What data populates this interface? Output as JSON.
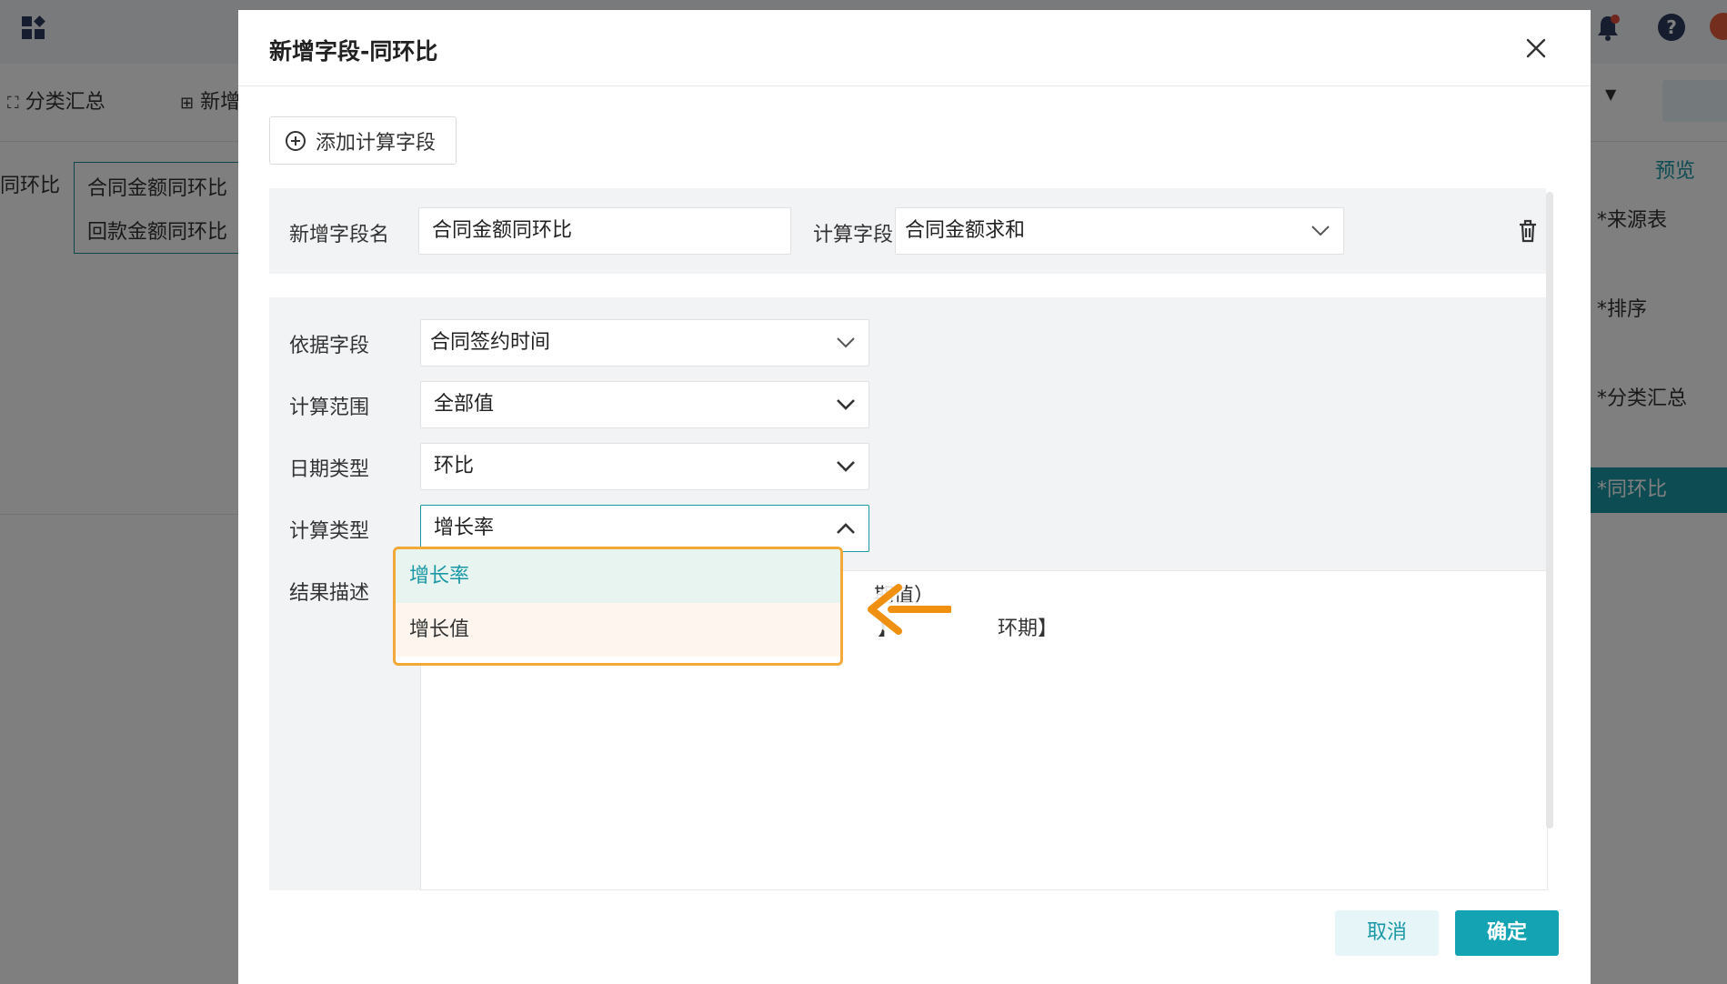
{
  "background": {
    "toolbar_items": [
      "分类汇总",
      "新增"
    ],
    "left_fields": [
      "合同金额同环比",
      "回款金额同环比"
    ],
    "left_label": "同环比",
    "preview_label": "预览",
    "steps": [
      {
        "label": "*来源表",
        "active": false
      },
      {
        "label": "*排序",
        "active": false
      },
      {
        "label": "*分类汇总",
        "active": false
      },
      {
        "label": "*同环比",
        "active": true
      }
    ]
  },
  "dialog": {
    "title": "新增字段-同环比",
    "add_button": "添加计算字段",
    "name_label": "新增字段名",
    "name_value": "合同金额同环比",
    "calc_field_label": "计算字段",
    "calc_field_value": "合同金额求和",
    "base_field_label": "依据字段",
    "base_field_value": "合同签约时间",
    "range_label": "计算范围",
    "range_value": "全部值",
    "date_type_label": "日期类型",
    "date_type_value": "环比",
    "calc_type_label": "计算类型",
    "calc_type_value": "增长率",
    "result_label": "结果描述",
    "result_line1": "期值）",
    "result_line2_left": "】",
    "result_line2_right": "环期】",
    "dropdown_options": [
      "增长率",
      "增长值"
    ],
    "cancel": "取消",
    "ok": "确定"
  },
  "colors": {
    "accent": "#1a98a6",
    "highlight": "#f3a93a"
  }
}
